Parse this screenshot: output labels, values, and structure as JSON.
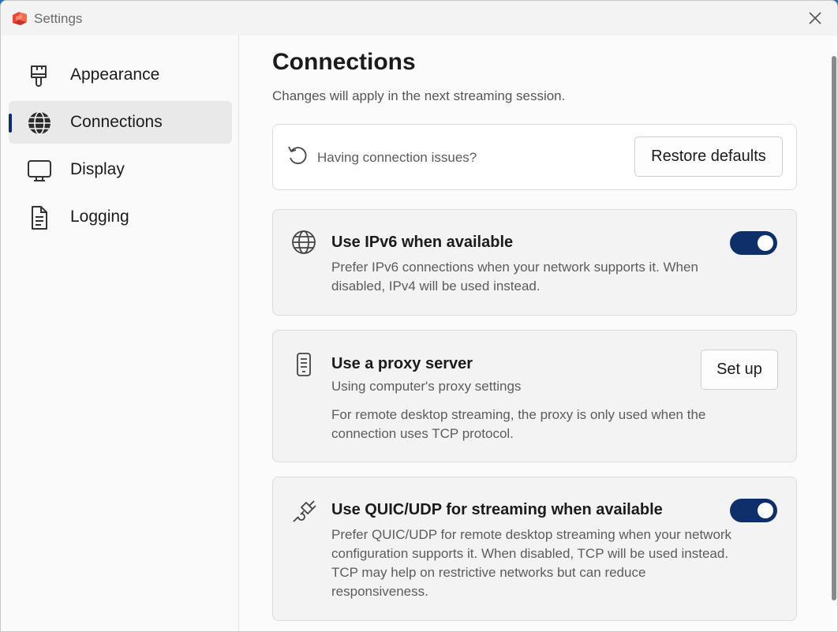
{
  "window": {
    "title": "Settings"
  },
  "sidebar": {
    "items": [
      {
        "label": "Appearance",
        "icon": "paintbrush-icon",
        "active": false
      },
      {
        "label": "Connections",
        "icon": "globe-icon",
        "active": true
      },
      {
        "label": "Display",
        "icon": "monitor-icon",
        "active": false
      },
      {
        "label": "Logging",
        "icon": "document-icon",
        "active": false
      }
    ]
  },
  "main": {
    "title": "Connections",
    "subtitle": "Changes will apply in the next streaming session.",
    "restore_card": {
      "icon": "undo-icon",
      "text": "Having connection issues?",
      "button_label": "Restore defaults"
    },
    "ipv6_card": {
      "icon": "globe-icon",
      "title": "Use IPv6 when available",
      "description": "Prefer IPv6 connections when your network supports it. When disabled, IPv4 will be used instead.",
      "enabled": true
    },
    "proxy_card": {
      "icon": "server-icon",
      "title": "Use a proxy server",
      "status": "Using computer's proxy settings",
      "description": "For remote desktop streaming, the proxy is only used when the connection uses TCP protocol.",
      "button_label": "Set up"
    },
    "quic_card": {
      "icon": "plug-icon",
      "title": "Use QUIC/UDP for streaming when available",
      "description": "Prefer QUIC/UDP for remote desktop streaming when your network configuration supports it. When disabled, TCP will be used instead. TCP may help on restrictive networks but can reduce responsiveness.",
      "enabled": true
    }
  },
  "colors": {
    "accent": "#0f2f6b",
    "window_bg": "#f3f3f3",
    "card_bg": "#f3f3f3"
  }
}
